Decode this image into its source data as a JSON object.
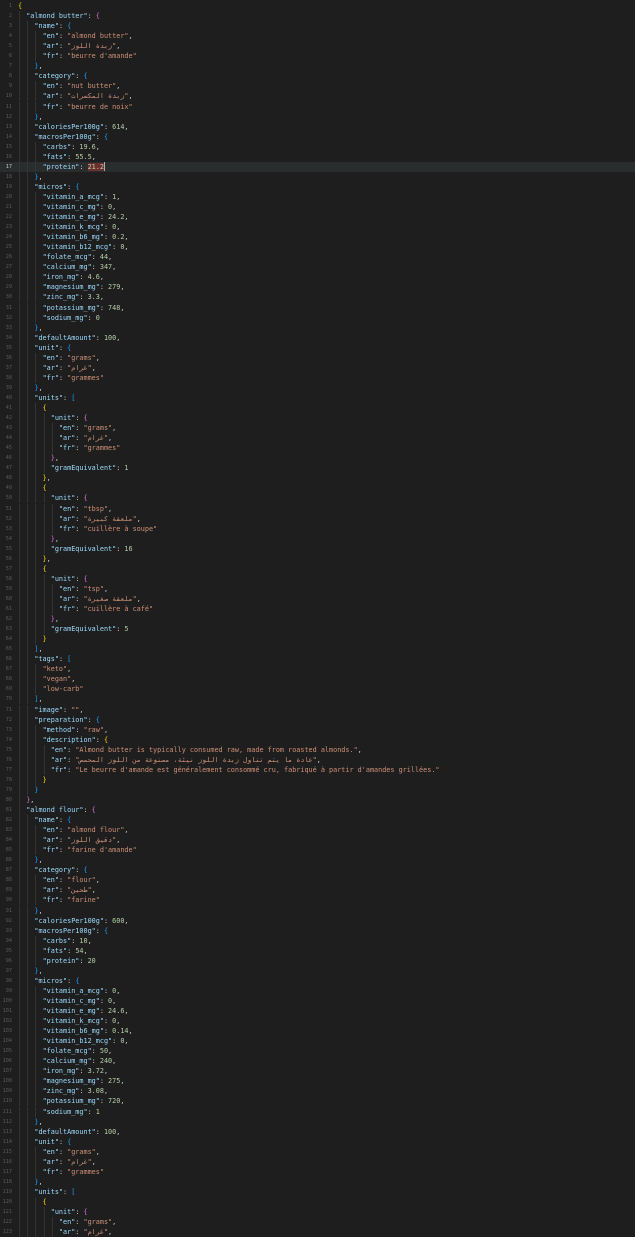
{
  "editor": {
    "language": "json",
    "current_line": 17,
    "colors": {
      "background": "#1e1e1e",
      "key": "#9cdcfe",
      "string": "#ce9178",
      "number": "#b5cea8",
      "bracket_level_0": "#ffd700",
      "bracket_level_1": "#da70d6",
      "bracket_level_2": "#179fff"
    },
    "line_numbers": [
      "1",
      "2",
      "3",
      "4",
      "5",
      "6",
      "7",
      "8",
      "9",
      "10",
      "11",
      "12",
      "13",
      "14",
      "15",
      "16",
      "17",
      "18",
      "19",
      "20",
      "21",
      "22",
      "23",
      "24",
      "25",
      "26",
      "27",
      "28",
      "29",
      "30",
      "31",
      "32",
      "33",
      "34",
      "35",
      "36",
      "37",
      "38",
      "39",
      "40",
      "41",
      "42",
      "43",
      "44",
      "45",
      "46",
      "47",
      "48",
      "49",
      "50",
      "51",
      "52",
      "53",
      "54",
      "55",
      "56",
      "57",
      "58",
      "59",
      "60",
      "61",
      "62",
      "63",
      "64",
      "65",
      "66",
      "67",
      "68",
      "69",
      "70",
      "71",
      "72",
      "73",
      "74",
      "75",
      "76",
      "77",
      "78",
      "79",
      "80",
      "81",
      "82",
      "83",
      "84",
      "85",
      "86",
      "87",
      "88",
      "89",
      "90",
      "91",
      "92",
      "93",
      "94",
      "95",
      "96",
      "97",
      "98",
      "99",
      "100",
      "101",
      "102",
      "103",
      "104",
      "105",
      "106",
      "107",
      "108",
      "109",
      "110",
      "111",
      "112",
      "113",
      "114",
      "115",
      "116",
      "117",
      "118",
      "119",
      "120",
      "121",
      "122",
      "123"
    ],
    "lines": [
      "{",
      "  \"almond butter\": {",
      "    \"name\": {",
      "      \"en\": \"almond butter\",",
      "      \"ar\": \"زبدة اللوز\",",
      "      \"fr\": \"beurre d'amande\"",
      "    },",
      "    \"category\": {",
      "      \"en\": \"nut butter\",",
      "      \"ar\": \"زبدة المكسرات\",",
      "      \"fr\": \"beurre de noix\"",
      "    },",
      "    \"caloriesPer100g\": 614,",
      "    \"macrosPer100g\": {",
      "      \"carbs\": 19.6,",
      "      \"fats\": 55.5,",
      "      \"protein\": 21.2",
      "    },",
      "    \"micros\": {",
      "      \"vitamin_a_mcg\": 1,",
      "      \"vitamin_c_mg\": 0,",
      "      \"vitamin_e_mg\": 24.2,",
      "      \"vitamin_k_mcg\": 0,",
      "      \"vitamin_b6_mg\": 0.2,",
      "      \"vitamin_b12_mcg\": 0,",
      "      \"folate_mcg\": 44,",
      "      \"calcium_mg\": 347,",
      "      \"iron_mg\": 4.6,",
      "      \"magnesium_mg\": 279,",
      "      \"zinc_mg\": 3.3,",
      "      \"potassium_mg\": 748,",
      "      \"sodium_mg\": 0",
      "    },",
      "    \"defaultAmount\": 100,",
      "    \"unit\": {",
      "      \"en\": \"grams\",",
      "      \"ar\": \"غرام\",",
      "      \"fr\": \"grammes\"",
      "    },",
      "    \"units\": [",
      "      {",
      "        \"unit\": {",
      "          \"en\": \"grams\",",
      "          \"ar\": \"غرام\",",
      "          \"fr\": \"grammes\"",
      "        },",
      "        \"gramEquivalent\": 1",
      "      },",
      "      {",
      "        \"unit\": {",
      "          \"en\": \"tbsp\",",
      "          \"ar\": \"ملعقة كبيرة\",",
      "          \"fr\": \"cuillère à soupe\"",
      "        },",
      "        \"gramEquivalent\": 16",
      "      },",
      "      {",
      "        \"unit\": {",
      "          \"en\": \"tsp\",",
      "          \"ar\": \"ملعقة صغيرة\",",
      "          \"fr\": \"cuillère à café\"",
      "        },",
      "        \"gramEquivalent\": 5",
      "      }",
      "    ],",
      "    \"tags\": [",
      "      \"keto\",",
      "      \"vegan\",",
      "      \"low-carb\"",
      "    ],",
      "    \"image\": \"\",",
      "    \"preparation\": {",
      "      \"method\": \"raw\",",
      "      \"description\": {",
      "        \"en\": \"Almond butter is typically consumed raw, made from roasted almonds.\",",
      "        \"ar\": \"عادة ما يتم تناول زبدة اللوز نيئة، مصنوعة من اللوز المحمص\",",
      "        \"fr\": \"Le beurre d'amande est généralement consommé cru, fabriqué à partir d'amandes grillées.\"",
      "      }",
      "    }",
      "  },",
      "  \"almond flour\": {",
      "    \"name\": {",
      "      \"en\": \"almond flour\",",
      "      \"ar\": \"دقيق اللوز\",",
      "      \"fr\": \"farine d'amande\"",
      "    },",
      "    \"category\": {",
      "      \"en\": \"flour\",",
      "      \"ar\": \"طحين\",",
      "      \"fr\": \"farine\"",
      "    },",
      "    \"caloriesPer100g\": 600,",
      "    \"macrosPer100g\": {",
      "      \"carbs\": 10,",
      "      \"fats\": 54,",
      "      \"protein\": 20",
      "    },",
      "    \"micros\": {",
      "      \"vitamin_a_mcg\": 0,",
      "      \"vitamin_c_mg\": 0,",
      "      \"vitamin_e_mg\": 24.6,",
      "      \"vitamin_k_mcg\": 0,",
      "      \"vitamin_b6_mg\": 0.14,",
      "      \"vitamin_b12_mcg\": 0,",
      "      \"folate_mcg\": 50,",
      "      \"calcium_mg\": 240,",
      "      \"iron_mg\": 3.72,",
      "      \"magnesium_mg\": 275,",
      "      \"zinc_mg\": 3.08,",
      "      \"potassium_mg\": 720,",
      "      \"sodium_mg\": 1",
      "    },",
      "    \"defaultAmount\": 100,",
      "    \"unit\": {",
      "      \"en\": \"grams\",",
      "      \"ar\": \"غرام\",",
      "      \"fr\": \"grammes\"",
      "    },",
      "    \"units\": [",
      "      {",
      "        \"unit\": {",
      "          \"en\": \"grams\",",
      "          \"ar\": \"غرام\","
    ]
  }
}
